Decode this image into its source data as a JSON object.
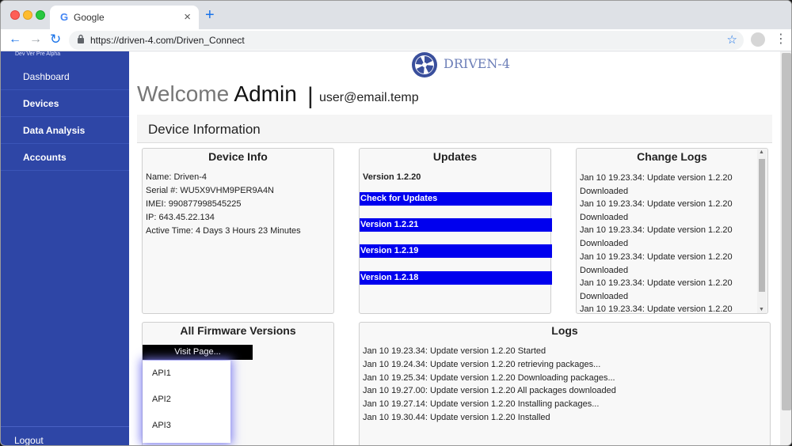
{
  "browser": {
    "tab_title": "Google",
    "tab_favicon": "G",
    "url": "https://driven-4.com/Driven_Connect"
  },
  "sidebar": {
    "version": "Dev Ver Pre Alpha",
    "items": [
      {
        "label": "Dashboard"
      },
      {
        "label": "Devices"
      },
      {
        "label": "Data Analysis"
      },
      {
        "label": "Accounts"
      }
    ],
    "logout": "Logout"
  },
  "header": {
    "brand": "DRIVEN-4",
    "welcome": "Welcome",
    "user": "Admin",
    "separator": "|",
    "email": "user@email.temp"
  },
  "section": {
    "title": "Device Information"
  },
  "device_info": {
    "title": "Device Info",
    "lines": [
      "Name: Driven-4",
      "Serial #: WU5X9VHM9PER9A4N",
      "IMEI: 990877998545225",
      "IP: 643.45.22.134",
      "Active Time: 4 Days 3 Hours 23 Minutes"
    ]
  },
  "updates": {
    "title": "Updates",
    "current": "Version 1.2.20",
    "buttons": [
      "Check for Updates",
      "Version 1.2.21",
      "Version 1.2.19",
      "Version 1.2.18"
    ]
  },
  "change_logs": {
    "title": "Change Logs",
    "entries": [
      "Jan 10 19.23.34: Update version 1.2.20 Downloaded",
      "Jan 10 19.23.34: Update version 1.2.20 Downloaded",
      "Jan 10 19.23.34: Update version 1.2.20 Downloaded",
      "Jan 10 19.23.34: Update version 1.2.20 Downloaded",
      "Jan 10 19.23.34: Update version 1.2.20 Downloaded",
      "Jan 10 19.23.34: Update version 1.2.20"
    ]
  },
  "firmware": {
    "title": "All Firmware Versions",
    "visit_button": "Visit Page...",
    "options": [
      "API1",
      "API2",
      "API3"
    ]
  },
  "logs": {
    "title": "Logs",
    "lines": [
      "Jan 10 19.23.34: Update version 1.2.20 Started",
      "Jan 10 19.24.34: Update version 1.2.20 retrieving packages...",
      "Jan 10 19.25.34: Update version 1.2.20 Downloading packages...",
      "Jan 10 19.27.00: Update version 1.2.20 All packages downloaded",
      "Jan 10 19.27.14: Update version 1.2.20 Installing packages...",
      "Jan 10 19.30.44: Update version 1.2.20 Installed"
    ]
  },
  "colors": {
    "sidebar": "#2e46a6",
    "update_button": "#0000ee"
  }
}
